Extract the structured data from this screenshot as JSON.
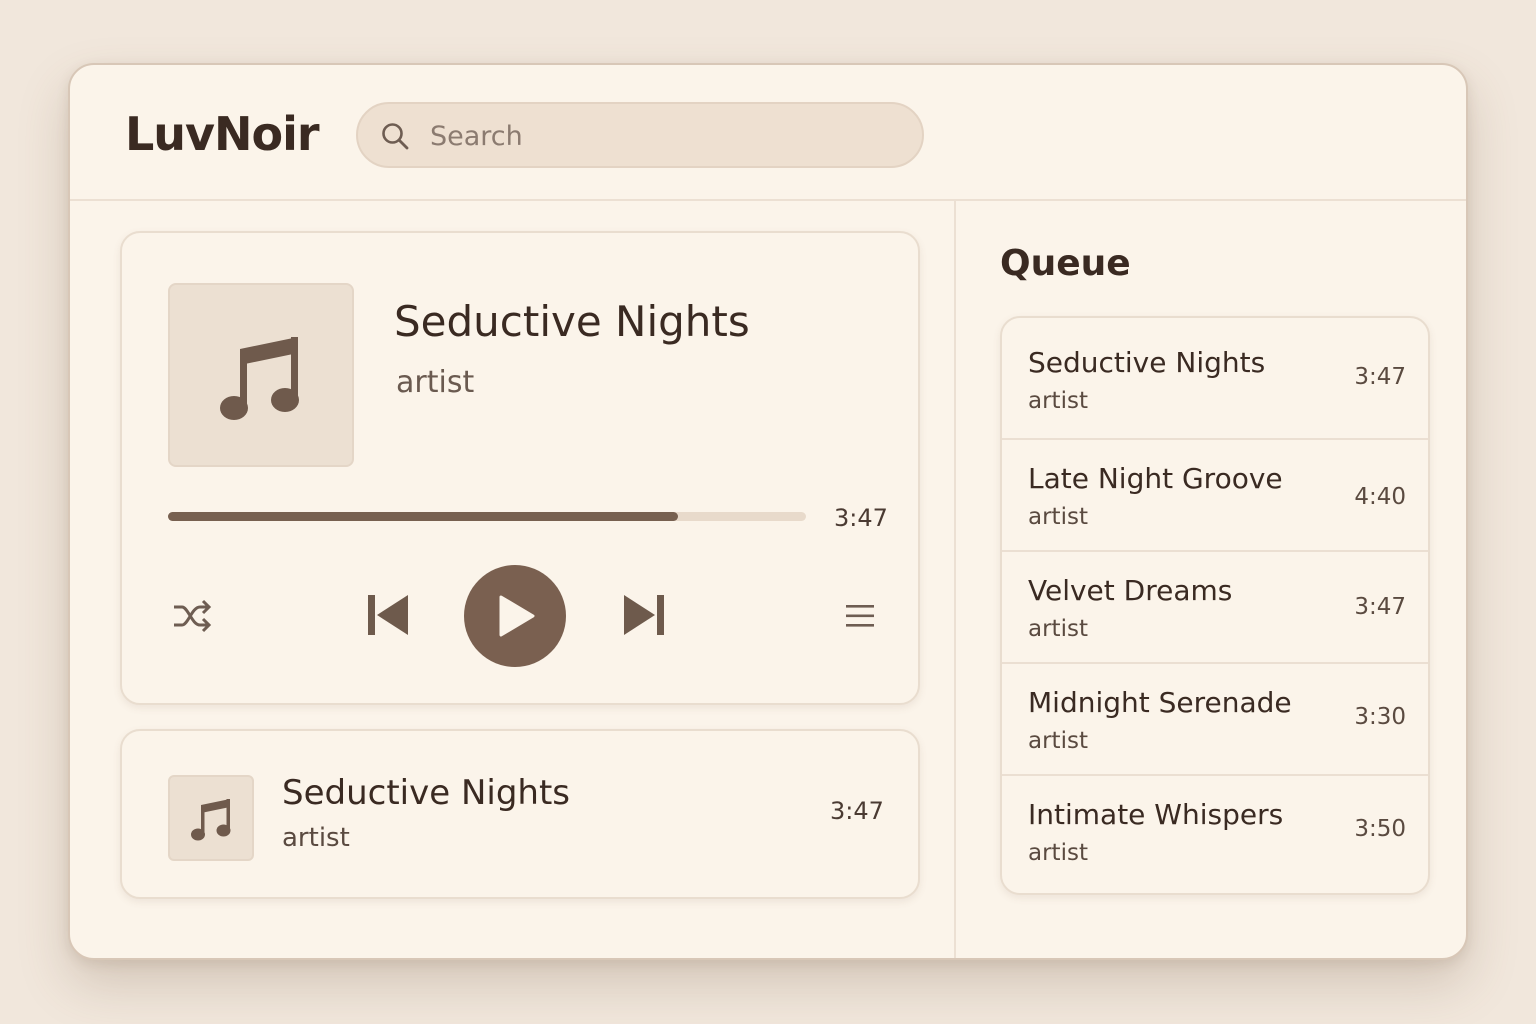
{
  "app": {
    "name": "LuvNoir"
  },
  "search": {
    "placeholder": "Search",
    "value": ""
  },
  "now_playing": {
    "title": "Seductive Nights",
    "artist": "artist",
    "time": "3:47",
    "progress": 0.8,
    "icons": {
      "album": "music-note-icon",
      "shuffle": "shuffle-icon",
      "previous": "skip-previous-icon",
      "play": "play-icon",
      "next": "skip-next-icon",
      "menu": "menu-icon"
    }
  },
  "mini_player": {
    "title": "Seductive Nights",
    "artist": "artist",
    "time": "3:47"
  },
  "queue": {
    "heading": "Queue",
    "items": [
      {
        "title": "Seductive Nights",
        "artist": "artist",
        "time": "3:47"
      },
      {
        "title": "Late Night Groove",
        "artist": "artist",
        "time": "4:40"
      },
      {
        "title": "Velvet Dreams",
        "artist": "artist",
        "time": "3:47"
      },
      {
        "title": "Midnight Serenade",
        "artist": "artist",
        "time": "3:30"
      },
      {
        "title": "Intimate Whispers",
        "artist": "artist",
        "time": "3:50"
      }
    ]
  },
  "colors": {
    "background": "#f1e7dc",
    "panel": "#fbf4ea",
    "accent": "#7a6050",
    "text": "#3a2a22"
  }
}
